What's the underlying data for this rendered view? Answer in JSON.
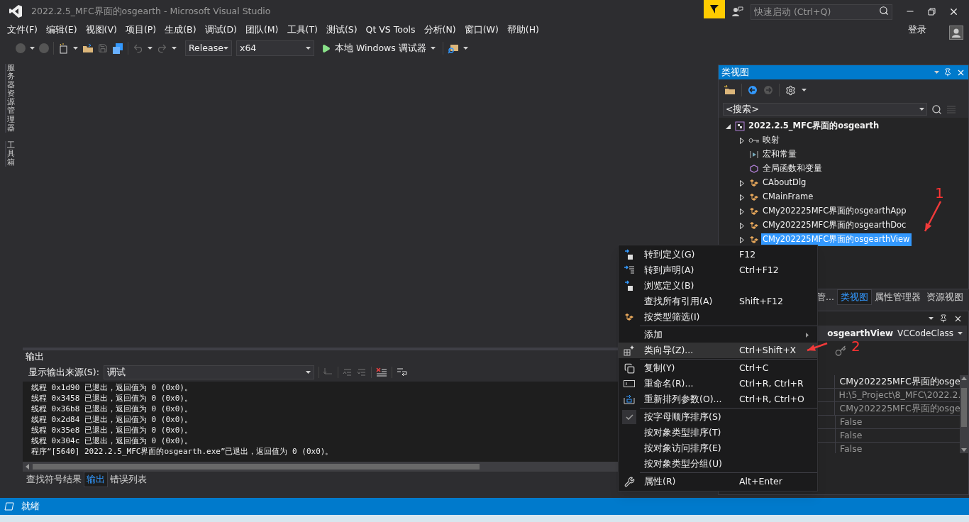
{
  "window": {
    "title": "2022.2.5_MFC界面的osgearth - Microsoft Visual Studio"
  },
  "quick_launch": {
    "placeholder": "快速启动 (Ctrl+Q)"
  },
  "menu_bar": [
    "文件(F)",
    "编辑(E)",
    "视图(V)",
    "项目(P)",
    "生成(B)",
    "调试(D)",
    "团队(M)",
    "工具(T)",
    "测试(S)",
    "Qt VS Tools",
    "分析(N)",
    "窗口(W)",
    "帮助(H)"
  ],
  "sign_in": "登录",
  "toolbar": {
    "configuration": "Release",
    "platform": "x64",
    "debugger": "本地 Windows 调试器"
  },
  "side_tabs": [
    "服务器资源管理器",
    "工具箱"
  ],
  "class_view": {
    "title": "类视图",
    "search": {
      "value": "<搜索>"
    },
    "tree": [
      {
        "label": "2022.2.5_MFC界面的osgearth",
        "kind": "project",
        "expanded": true,
        "selected": false,
        "children": [
          {
            "label": "映射",
            "kind": "map",
            "expanded": false,
            "selected": false
          },
          {
            "label": "宏和常量",
            "kind": "macro",
            "selected": false
          },
          {
            "label": "全局函数和变量",
            "kind": "globals",
            "selected": false
          },
          {
            "label": "CAboutDlg",
            "kind": "class",
            "expanded": false,
            "selected": false
          },
          {
            "label": "CMainFrame",
            "kind": "class",
            "expanded": false,
            "selected": false
          },
          {
            "label": "CMy202225MFC界面的osgearthApp",
            "kind": "class",
            "expanded": false,
            "selected": false
          },
          {
            "label": "CMy202225MFC界面的osgearthDoc",
            "kind": "class",
            "expanded": false,
            "selected": false
          },
          {
            "label": "CMy202225MFC界面的osgearthView",
            "kind": "class",
            "expanded": false,
            "selected": true
          }
        ]
      }
    ]
  },
  "right_tabs": [
    {
      "label": "管...",
      "selected": false
    },
    {
      "label": "类视图",
      "selected": true
    },
    {
      "label": "属性管理器",
      "selected": false
    },
    {
      "label": "资源视图",
      "selected": false
    }
  ],
  "properties": {
    "object": "osgearthView",
    "object_type": "VCCodeClass",
    "values": [
      "CMy202225MFC界面的osge",
      "H:\\5_Project\\8_MFC\\2022.2.",
      "CMy202225MFC界面的osge",
      "False",
      "False",
      "False"
    ]
  },
  "output": {
    "title": "输出",
    "source_label": "显示输出来源(S):",
    "source": "调试",
    "lines": [
      "线程 0x1d90 已退出，返回值为 0 (0x0)。",
      "线程 0x3458 已退出，返回值为 0 (0x0)。",
      "线程 0x36b8 已退出，返回值为 0 (0x0)。",
      "线程 0x2d84 已退出，返回值为 0 (0x0)。",
      "线程 0x35e8 已退出，返回值为 0 (0x0)。",
      "线程 0x304c 已退出，返回值为 0 (0x0)。",
      "程序“[5640] 2022.2.5_MFC界面的osgearth.exe”已退出，返回值为 0 (0x0)。"
    ],
    "tabs": [
      {
        "label": "查找符号结果",
        "selected": false
      },
      {
        "label": "输出",
        "selected": true
      },
      {
        "label": "错误列表",
        "selected": false
      }
    ]
  },
  "context_menu": [
    {
      "kind": "item",
      "label": "转到定义(G)",
      "shortcut": "F12",
      "selected": false,
      "checked": false
    },
    {
      "kind": "item",
      "label": "转到声明(A)",
      "shortcut": "Ctrl+F12",
      "selected": false,
      "checked": false
    },
    {
      "kind": "item",
      "label": "浏览定义(B)",
      "selected": false,
      "checked": false
    },
    {
      "kind": "item",
      "label": "查找所有引用(A)",
      "shortcut": "Shift+F12",
      "selected": false,
      "checked": false
    },
    {
      "kind": "item",
      "label": "按类型筛选(I)",
      "selected": false,
      "checked": false
    },
    {
      "kind": "separator"
    },
    {
      "kind": "submenu",
      "label": "添加",
      "selected": false,
      "checked": false
    },
    {
      "kind": "item",
      "label": "类向导(Z)...",
      "shortcut": "Ctrl+Shift+X",
      "selected": true,
      "checked": false
    },
    {
      "kind": "separator"
    },
    {
      "kind": "item",
      "label": "复制(Y)",
      "shortcut": "Ctrl+C",
      "selected": false,
      "checked": false
    },
    {
      "kind": "item",
      "label": "重命名(R)...",
      "shortcut": "Ctrl+R, Ctrl+R",
      "selected": false,
      "checked": false
    },
    {
      "kind": "item",
      "label": "重新排列参数(O)...",
      "shortcut": "Ctrl+R, Ctrl+O",
      "selected": false,
      "checked": false
    },
    {
      "kind": "separator"
    },
    {
      "kind": "item",
      "label": "按字母顺序排序(S)",
      "selected": false,
      "checked": true
    },
    {
      "kind": "item",
      "label": "按对象类型排序(T)",
      "selected": false,
      "checked": false
    },
    {
      "kind": "item",
      "label": "按对象访问排序(E)",
      "selected": false,
      "checked": false
    },
    {
      "kind": "item",
      "label": "按对象类型分组(U)",
      "selected": false,
      "checked": false
    },
    {
      "kind": "separator"
    },
    {
      "kind": "item",
      "label": "属性(R)",
      "shortcut": "Alt+Enter",
      "selected": false,
      "checked": false
    }
  ],
  "annotations": [
    {
      "label": "1"
    },
    {
      "label": "2"
    }
  ],
  "status_bar": {
    "text": "就绪"
  }
}
